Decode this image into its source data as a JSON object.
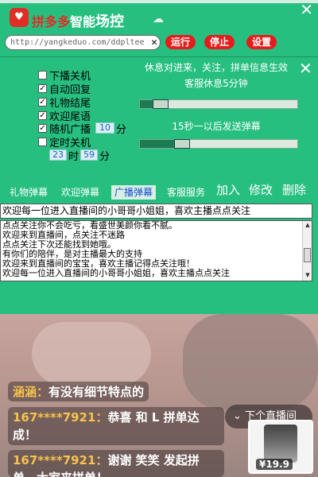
{
  "window": {
    "brand_prefix": "拼多多",
    "brand_middle": "智能",
    "brand_suffix": "场控",
    "logo_glyph": "♥",
    "close_glyph": "✕"
  },
  "urlbar": {
    "value": "http://yangkeduo.com/ddpltee",
    "clear_glyph": "✕",
    "run_label": "运行",
    "stop_label": "停止",
    "settings_label": "设置"
  },
  "settings": {
    "checkboxes": [
      {
        "label": "下播关机",
        "checked": false
      },
      {
        "label": "自动回复",
        "checked": true
      },
      {
        "label": "礼物结尾",
        "checked": true
      },
      {
        "label": "欢迎尾语",
        "checked": true
      },
      {
        "label": "随机广播",
        "checked": true
      },
      {
        "label": "定时关机",
        "checked": false
      }
    ],
    "broadcast_minutes": "10",
    "broadcast_unit": "分",
    "shutdown_hour": "23",
    "hour_unit": "时",
    "shutdown_minute": "59",
    "minute_unit": "分",
    "info_line1": "休息对进来，关注，拼单信息生效",
    "info_line2": "客服休息5分钟",
    "info_line3": "15秒一以后发送弹幕",
    "slider1_level": 0.13,
    "slider2_level": 0.27,
    "close_glyph": "✕"
  },
  "tabs": [
    {
      "label": "礼物弹幕",
      "active": false
    },
    {
      "label": "欢迎弹幕",
      "active": false
    },
    {
      "label": "广播弹幕",
      "active": true
    },
    {
      "label": "客服服务",
      "active": false
    }
  ],
  "actions": {
    "add": "加入",
    "edit": "修改",
    "delete": "删除"
  },
  "editor": {
    "current_line": "欢迎每一位进入直播间的小哥哥小姐姐，喜欢主播点点关注",
    "lines": [
      "点点关注你不会吃亏，看盛世美颜你看不腻。",
      "欢迎来到直播间，点关注不迷路",
      "点点关注下次还能找到她哦。",
      "有你们的陪伴，是对主播最大的支持",
      "欢迎来到直播间的宝宝，喜欢主播记得点关注哦！",
      "欢迎每一位进入直播间的小哥哥小姐姐，喜欢主播点点关注"
    ]
  },
  "live": {
    "comments": [
      {
        "user": "涵涵：",
        "text": "有没有细节特点的"
      },
      {
        "user": "167****7921：",
        "text": "恭喜 和 L 拼单达成！"
      },
      {
        "user": "167****7921：",
        "text": "谢谢 笑笑 发起拼单，大家来拼单！"
      }
    ],
    "next_label": "下个直播间",
    "next_glyph": "⌄",
    "price": "¥19.9"
  }
}
